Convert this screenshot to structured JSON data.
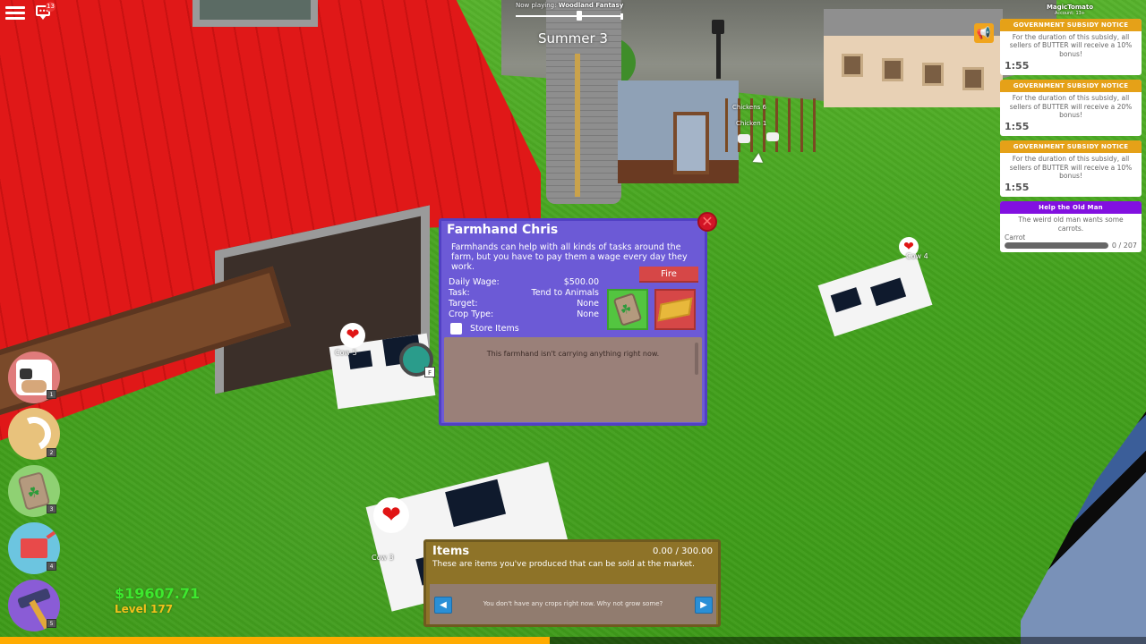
{
  "hud": {
    "menu_icon": "hamburger-menu-icon",
    "chat_icon": "chat-bubble-icon",
    "chat_badge": "13"
  },
  "music": {
    "label": "Now playing:",
    "track": "Woodland Fantasy",
    "volume_fraction": 0.6
  },
  "season": "Summer 3",
  "account": {
    "name": "MagicTomato",
    "type": "Account: 13+"
  },
  "announce_icon": "megaphone-icon",
  "notices": [
    {
      "title": "GOVERNMENT SUBSIDY NOTICE",
      "body": "For the duration of this subsidy, all sellers of BUTTER will receive a 10% bonus!",
      "timer": "1:55"
    },
    {
      "title": "GOVERNMENT SUBSIDY NOTICE",
      "body": "For the duration of this subsidy, all sellers of BUTTER will receive a 20% bonus!",
      "timer": "1:55"
    },
    {
      "title": "GOVERNMENT SUBSIDY NOTICE",
      "body": "For the duration of this subsidy, all sellers of BUTTER will receive a 10% bonus!",
      "timer": "1:55"
    }
  ],
  "quest": {
    "title": "Help the Old Man",
    "body": "The weird old man wants some carrots.",
    "item": "Carrot",
    "progress": "0 / 207",
    "progress_fraction": 0
  },
  "farmhand": {
    "title": "Farmhand Chris",
    "description": "Farmhands can help with all kinds of tasks around the farm, but you have to pay them a wage every day they work.",
    "stats": [
      {
        "label": "Daily Wage:",
        "value": "$500.00"
      },
      {
        "label": "Task:",
        "value": "Tend to Animals"
      },
      {
        "label": "Target:",
        "value": "None"
      },
      {
        "label": "Crop Type:",
        "value": "None"
      }
    ],
    "fire_label": "Fire",
    "store_items_label": "Store Items",
    "store_items_checked": false,
    "inventory_message": "This farmhand isn't carrying anything right now.",
    "close_icon": "close-icon"
  },
  "items": {
    "title": "Items",
    "capacity": "0.00 / 300.00",
    "description": "These are items you've produced that can be sold at the market.",
    "empty_message": "You don't have any crops right now. Why not grow some?"
  },
  "hotbar": [
    {
      "key": "1",
      "icon": "cow-icon",
      "color": "#e07b7b"
    },
    {
      "key": "2",
      "icon": "sickle-icon",
      "color": "#e8c27c"
    },
    {
      "key": "3",
      "icon": "seed-bag-icon",
      "color": "#8fd173"
    },
    {
      "key": "4",
      "icon": "watering-can-icon",
      "color": "#6cc5e0"
    },
    {
      "key": "5",
      "icon": "hammer-icon",
      "color": "#8a5cd6"
    }
  ],
  "player": {
    "money": "$19607.71",
    "level": "Level 177",
    "xp_fraction": 0.48
  },
  "world_labels": {
    "cow_5": "Cow 5",
    "cow_4": "Cow 4",
    "cow_3": "Cow 3",
    "chickens_1": "Chickens 6",
    "chickens_2": "Chicken 1",
    "interact_key": "F"
  },
  "colors": {
    "farmhand_panel": "#6c5ad6",
    "items_panel": "#8e7328",
    "notice_header": "#e5a118",
    "quest_header": "#8210e0",
    "money": "#3ee82e",
    "level": "#f2c11b",
    "xp_fill": "#ffab00"
  }
}
